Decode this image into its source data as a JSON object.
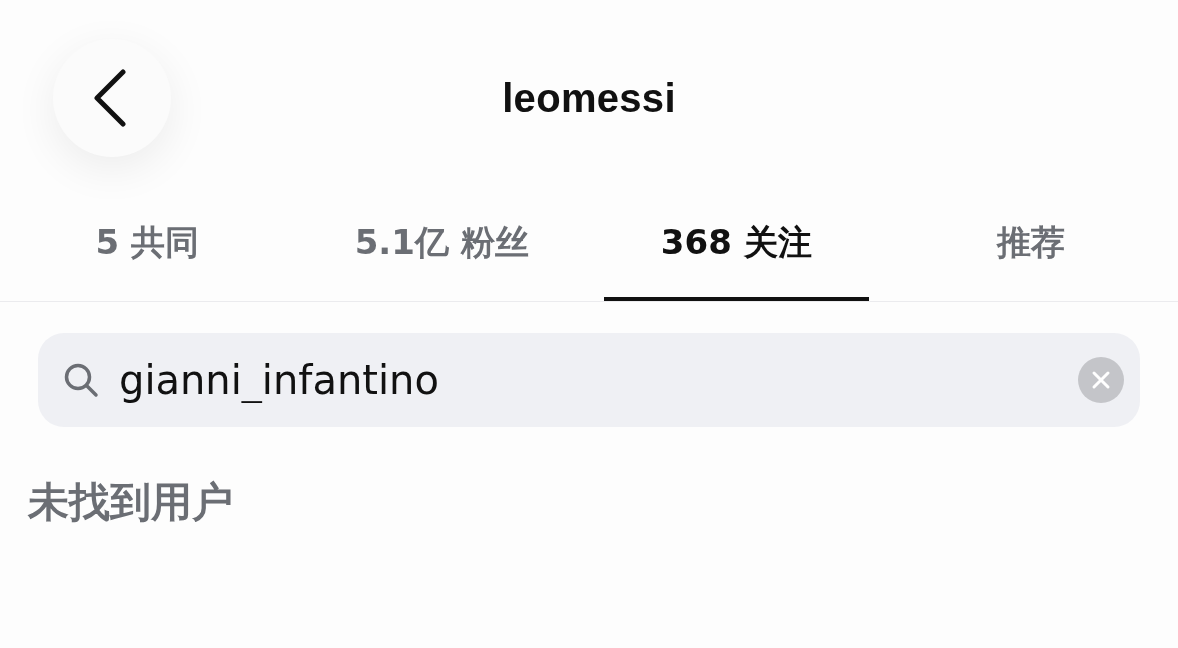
{
  "header": {
    "title": "leomessi"
  },
  "tabs": [
    {
      "label": "5 共同",
      "selected": false
    },
    {
      "label": "5.1亿 粉丝",
      "selected": false
    },
    {
      "label": "368 关注",
      "selected": true
    },
    {
      "label": "推荐",
      "selected": false
    }
  ],
  "search": {
    "value": "gianni_infantino"
  },
  "empty_message": "未找到用户"
}
